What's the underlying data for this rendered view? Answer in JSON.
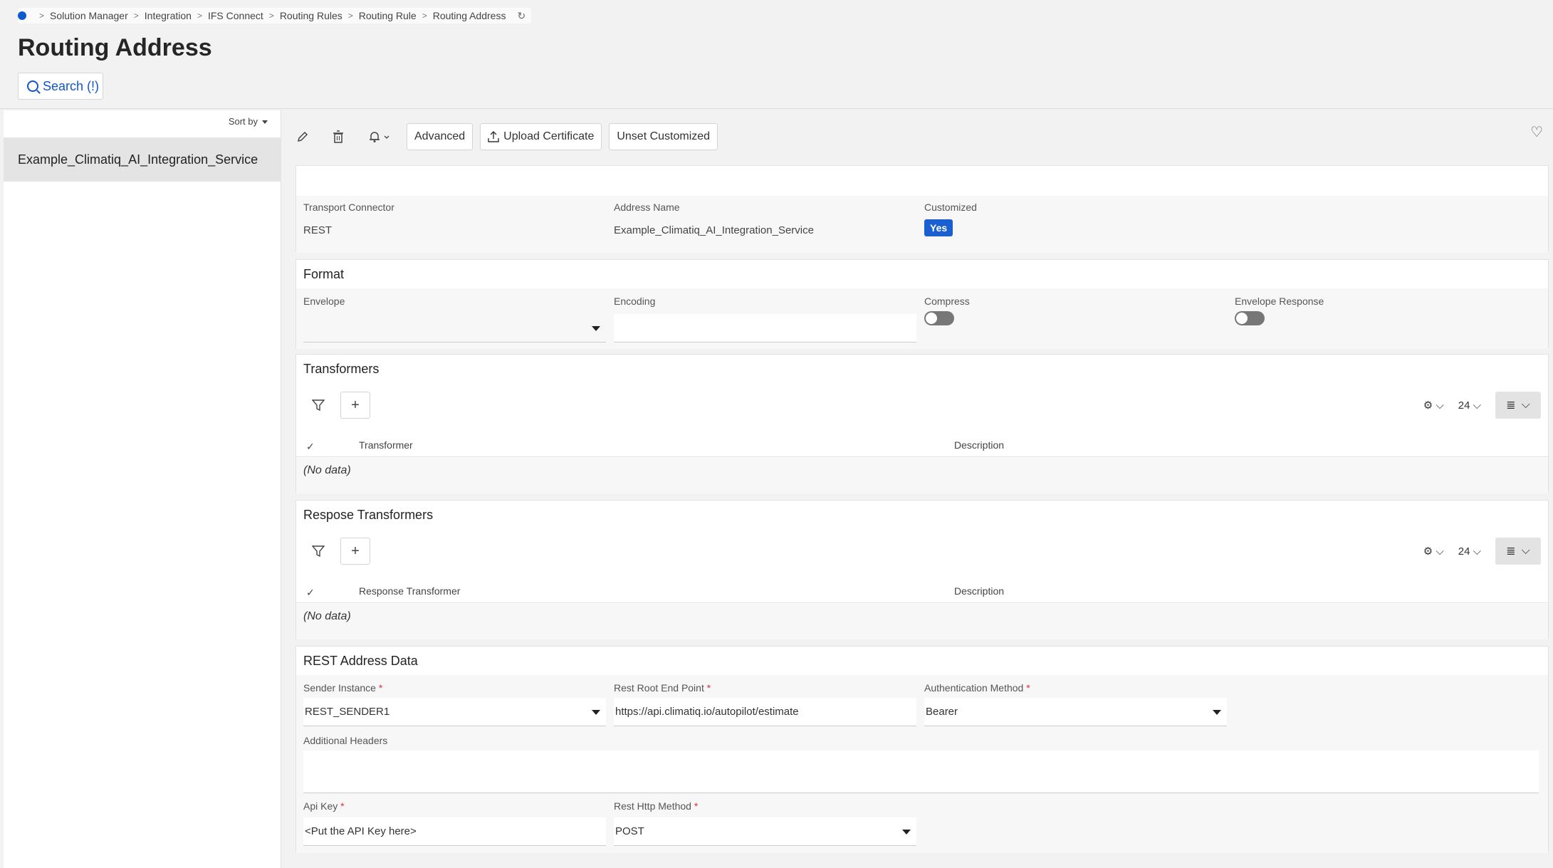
{
  "breadcrumb": [
    "Solution Manager",
    "Integration",
    "IFS Connect",
    "Routing Rules",
    "Routing Rule",
    "Routing Address"
  ],
  "page_title": "Routing Address",
  "search_label": "Search (!)",
  "list": {
    "sort_label": "Sort by",
    "items": [
      "Example_Climatiq_AI_Integration_Service"
    ]
  },
  "toolbar": {
    "advanced": "Advanced",
    "upload_certificate": "Upload Certificate",
    "unset_customized": "Unset Customized"
  },
  "general": {
    "transport_connector_label": "Transport Connector",
    "transport_connector_value": "REST",
    "address_name_label": "Address Name",
    "address_name_value": "Example_Climatiq_AI_Integration_Service",
    "customized_label": "Customized",
    "customized_value": "Yes"
  },
  "format": {
    "title": "Format",
    "envelope_label": "Envelope",
    "envelope_value": "",
    "encoding_label": "Encoding",
    "encoding_value": "",
    "compress_label": "Compress",
    "envelope_response_label": "Envelope Response"
  },
  "transformers": {
    "title": "Transformers",
    "page_size": "24",
    "col_transformer": "Transformer",
    "col_description": "Description",
    "no_data": "(No data)"
  },
  "response_transformers": {
    "title": "Respose Transformers",
    "page_size": "24",
    "col_transformer": "Response Transformer",
    "col_description": "Description",
    "no_data": "(No data)"
  },
  "rest": {
    "title": "REST Address Data",
    "sender_instance_label": "Sender Instance",
    "sender_instance_value": "REST_SENDER1",
    "root_end_point_label": "Rest Root End Point",
    "root_end_point_value": "https://api.climatiq.io/autopilot/estimate",
    "auth_method_label": "Authentication Method",
    "auth_method_value": "Bearer",
    "additional_headers_label": "Additional Headers",
    "additional_headers_value": "",
    "api_key_label": "Api Key",
    "api_key_value": "<Put the API Key here>",
    "http_method_label": "Rest Http Method",
    "http_method_value": "POST",
    "required_mark": "*"
  },
  "colors": {
    "accent": "#1a5fd0",
    "required": "#dd3333",
    "top_indicator": "#e84b4b"
  }
}
